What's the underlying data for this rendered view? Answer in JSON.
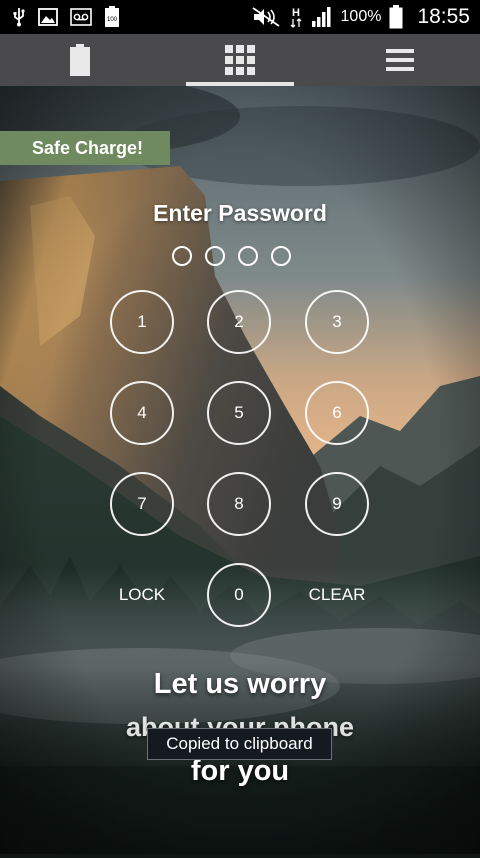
{
  "status_bar": {
    "battery_percent": "100%",
    "time": "18:55",
    "notification_icons": [
      "usb-icon",
      "image-icon",
      "voicemail-icon",
      "battery-100-notification-icon"
    ],
    "system_icons": [
      "nfc-muted-icon",
      "hspa-data-icon",
      "signal-icon",
      "battery-icon"
    ]
  },
  "tabs": [
    {
      "icon": "battery-icon"
    },
    {
      "icon": "grid-icon",
      "active": true
    },
    {
      "icon": "menu-icon"
    }
  ],
  "lock_screen": {
    "banner": "Safe Charge!",
    "title": "Enter Password",
    "pin_dots": 4,
    "keys": [
      "1",
      "2",
      "3",
      "4",
      "5",
      "6",
      "7",
      "8",
      "9"
    ],
    "lock_label": "LOCK",
    "zero_label": "0",
    "clear_label": "CLEAR",
    "promo_line1": "Let us worry",
    "promo_line2": "about your phone",
    "promo_line3": "for you"
  },
  "toast": "Copied to clipboard",
  "colors": {
    "banner_green": "#6f8a5e",
    "tabbar_gray": "#4a4a4c",
    "status_black": "#000000"
  }
}
